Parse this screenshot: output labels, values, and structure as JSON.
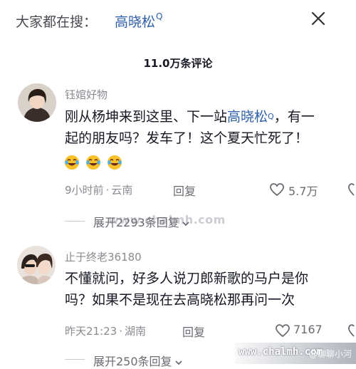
{
  "header": {
    "search_prefix": "大家都在搜：",
    "search_term": "高晓松",
    "search_mark": "Q"
  },
  "comment_count": "11.0万条评论",
  "comments": [
    {
      "username": "钰婠好物",
      "text_line1_before": "刚从杨坤来到这里、下一站",
      "link_text": "高晓松",
      "link_mark": "Q",
      "text_line1_after": "，有一",
      "text_line2": "起的朋友吗？发车了！这个夏天忙死了！",
      "emojis": [
        "laugh-cry",
        "laugh-cry",
        "laugh-cry"
      ],
      "time": "9小时前",
      "location": "云南",
      "separator": "·",
      "reply_label": "回复",
      "likes": "5.7万",
      "expand_label": "展开2293条回复"
    },
    {
      "username": "止于终老36180",
      "text_line1": "不懂就问，好多人说刀郎新歌的马户是你",
      "text_line2": "吗？如果不是现在去高晓松那再问一次",
      "time": "昨天21:23",
      "location": "湖南",
      "separator": "·",
      "reply_label": "回复",
      "likes": "7167",
      "expand_label": "展开250条回复"
    }
  ],
  "watermark": "www.chalmh.com",
  "badge": {
    "url": "www.chalmh.com",
    "wm": "@聊聊小河"
  },
  "colors": {
    "link": "#2f5fa8",
    "muted": "#8a8b91",
    "text": "#161823"
  }
}
